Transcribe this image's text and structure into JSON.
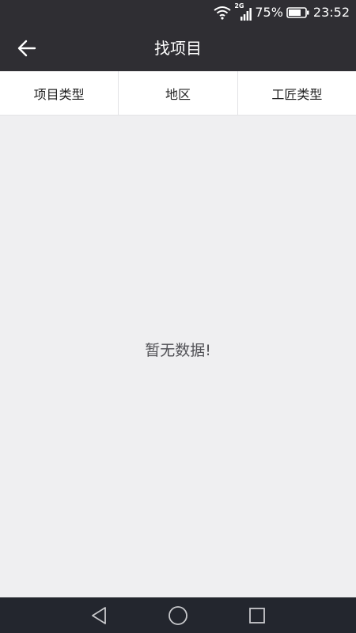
{
  "status_bar": {
    "network_type": "2G",
    "battery_percent": "75%",
    "battery_level": 0.75,
    "time": "23:52",
    "icons": [
      "wifi-icon",
      "signal-icon",
      "battery-icon"
    ]
  },
  "app_bar": {
    "title": "找项目",
    "back_icon": "arrow-left-icon"
  },
  "filters": [
    {
      "label": "项目类型"
    },
    {
      "label": "地区"
    },
    {
      "label": "工匠类型"
    }
  ],
  "empty_state": {
    "message": "暂无数据!"
  },
  "nav_bar": {
    "icons": [
      "nav-back-icon",
      "nav-home-icon",
      "nav-recents-icon"
    ]
  },
  "colors": {
    "app_bar_bg": "#2f2e33",
    "page_bg": "#efeff1",
    "nav_bar_bg": "#23262e"
  }
}
